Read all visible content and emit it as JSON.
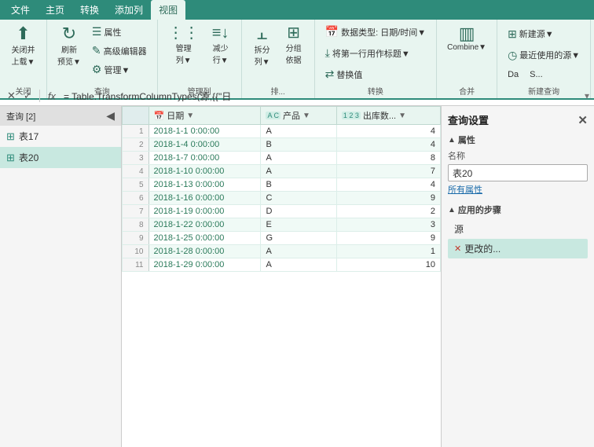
{
  "ribbon": {
    "tabs": [
      "文件",
      "主页",
      "转换",
      "添加列",
      "视图"
    ],
    "active_tab": "主页",
    "groups": [
      {
        "name": "关闭",
        "items": [
          {
            "id": "close-upload",
            "icon": "⬆",
            "label": "关闭并\n上载▼"
          }
        ]
      },
      {
        "name": "查询",
        "items": [
          {
            "id": "refresh",
            "icon": "↻",
            "label": "刷新\n预览▼"
          },
          {
            "id": "properties",
            "icon": "☰",
            "label": "属性"
          },
          {
            "id": "adv-editor",
            "icon": "✎",
            "label": "高级编辑器"
          },
          {
            "id": "manage",
            "icon": "⚙",
            "label": "管理▼"
          }
        ]
      },
      {
        "name": "管理列",
        "items": [
          {
            "id": "manage-cols",
            "icon": "⋮⋮",
            "label": "管理\n列▼"
          },
          {
            "id": "reduce-rows",
            "icon": "≡↓",
            "label": "减少\n行▼"
          }
        ]
      },
      {
        "name": "排序",
        "items": [
          {
            "id": "split-col",
            "icon": "⫠",
            "label": "拆分\n列▼"
          },
          {
            "id": "group-by",
            "icon": "⊞",
            "label": "分组\n依据"
          }
        ]
      },
      {
        "name": "转换",
        "items": [
          {
            "id": "data-type",
            "label": "数据类型: 日期/时间▼",
            "small": true
          },
          {
            "id": "first-row",
            "label": "将第一行用作标题▼",
            "small": true
          },
          {
            "id": "replace-val",
            "label": "替换值",
            "small": true
          }
        ]
      },
      {
        "name": "合并",
        "items": [
          {
            "id": "combine",
            "icon": "▥",
            "label": "Combine▼"
          }
        ]
      },
      {
        "name": "新建查询",
        "items": [
          {
            "id": "new-source",
            "icon": "⊞",
            "label": "新建源▼",
            "small": true
          },
          {
            "id": "recent-source",
            "icon": "◷",
            "label": "最近使用的源▼",
            "small": true
          },
          {
            "id": "da1",
            "label": "Da...",
            "small": true
          },
          {
            "id": "da2",
            "label": "S...",
            "small": true
          }
        ]
      }
    ]
  },
  "formula_bar": {
    "cancel_label": "✕",
    "confirm_label": "✓",
    "fx_label": "fx",
    "formula": "= Table.TransformColumnTypes(源,{{\"日",
    "expand_label": "▾"
  },
  "sidebar": {
    "title": "查询 [2]",
    "items": [
      {
        "id": "table17",
        "label": "表17",
        "active": false
      },
      {
        "id": "table20",
        "label": "表20",
        "active": true
      }
    ]
  },
  "table": {
    "columns": [
      {
        "id": "row-num",
        "label": "",
        "type": ""
      },
      {
        "id": "date",
        "label": "日期",
        "type": "datetime"
      },
      {
        "id": "product",
        "label": "产品",
        "type": "text"
      },
      {
        "id": "output",
        "label": "出库数...",
        "type": "number"
      }
    ],
    "rows": [
      {
        "num": "1",
        "date": "2018-1-1 0:00:00",
        "product": "A",
        "output": "4"
      },
      {
        "num": "2",
        "date": "2018-1-4 0:00:00",
        "product": "B",
        "output": "4"
      },
      {
        "num": "3",
        "date": "2018-1-7 0:00:00",
        "product": "A",
        "output": "8"
      },
      {
        "num": "4",
        "date": "2018-1-10 0:00:00",
        "product": "A",
        "output": "7"
      },
      {
        "num": "5",
        "date": "2018-1-13 0:00:00",
        "product": "B",
        "output": "4"
      },
      {
        "num": "6",
        "date": "2018-1-16 0:00:00",
        "product": "C",
        "output": "9"
      },
      {
        "num": "7",
        "date": "2018-1-19 0:00:00",
        "product": "D",
        "output": "2"
      },
      {
        "num": "8",
        "date": "2018-1-22 0:00:00",
        "product": "E",
        "output": "3"
      },
      {
        "num": "9",
        "date": "2018-1-25 0:00:00",
        "product": "G",
        "output": "9"
      },
      {
        "num": "10",
        "date": "2018-1-28 0:00:00",
        "product": "A",
        "output": "1"
      },
      {
        "num": "11",
        "date": "2018-1-29 0:00:00",
        "product": "A",
        "output": "10"
      }
    ]
  },
  "query_settings": {
    "title": "查询设置",
    "close_label": "✕",
    "properties_section": "属性",
    "name_label": "名称",
    "name_value": "表20",
    "all_props_label": "所有属性",
    "steps_section": "应用的步骤",
    "steps": [
      {
        "id": "source",
        "label": "源",
        "has_error": false
      },
      {
        "id": "changed",
        "label": "更改的...",
        "has_error": true
      }
    ]
  }
}
